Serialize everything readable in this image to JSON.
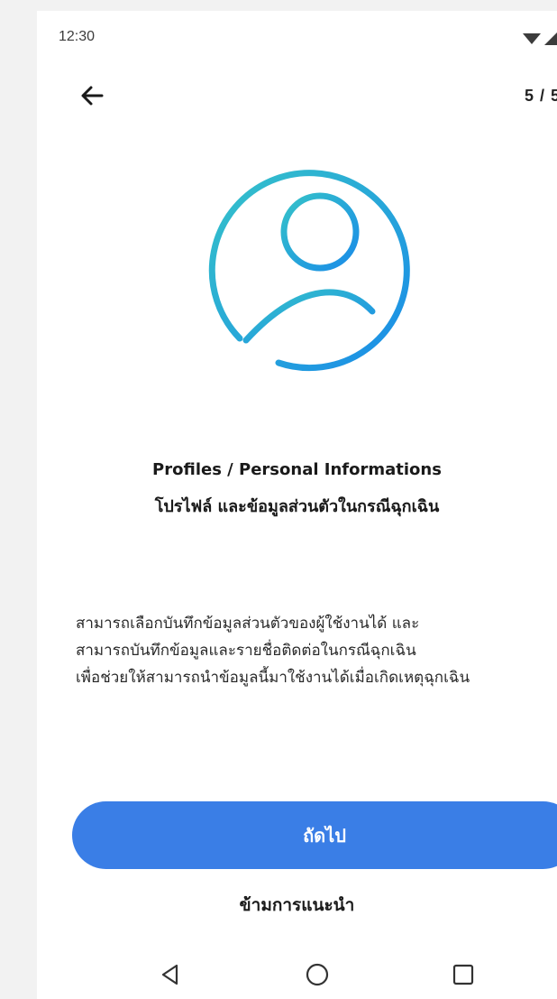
{
  "status_bar": {
    "time": "12:30",
    "icons": [
      "wifi-icon",
      "signal-icon"
    ]
  },
  "header": {
    "back_icon": "arrow-left-icon",
    "page_indicator": "5 / 5"
  },
  "hero": {
    "icon": "user-profile-icon",
    "gradient_start": "#35c2c9",
    "gradient_end": "#1a8ce8"
  },
  "titles": {
    "english": "Profiles / Personal Informations",
    "thai": "โปรไฟล์ และข้อมูลส่วนตัวในกรณีฉุกเฉิน"
  },
  "description": {
    "lines": [
      "สามารถเลือกบันทึกข้อมูลส่วนตัวของผู้ใช้งานได้ และ",
      "สามารถบันทึกข้อมูลและรายชื่อติดต่อในกรณีฉุกเฉิน",
      "เพื่อช่วยให้สามารถนำข้อมูลนี้มาใช้งานได้เมื่อเกิดเหตุฉุกเฉิน"
    ]
  },
  "actions": {
    "next_label": "ถัดไป",
    "skip_label": "ข้ามการแนะนำ",
    "primary_color": "#3a7ee6"
  },
  "nav_bar": {
    "buttons": [
      "back-triangle-icon",
      "home-circle-icon",
      "recents-square-icon"
    ]
  }
}
